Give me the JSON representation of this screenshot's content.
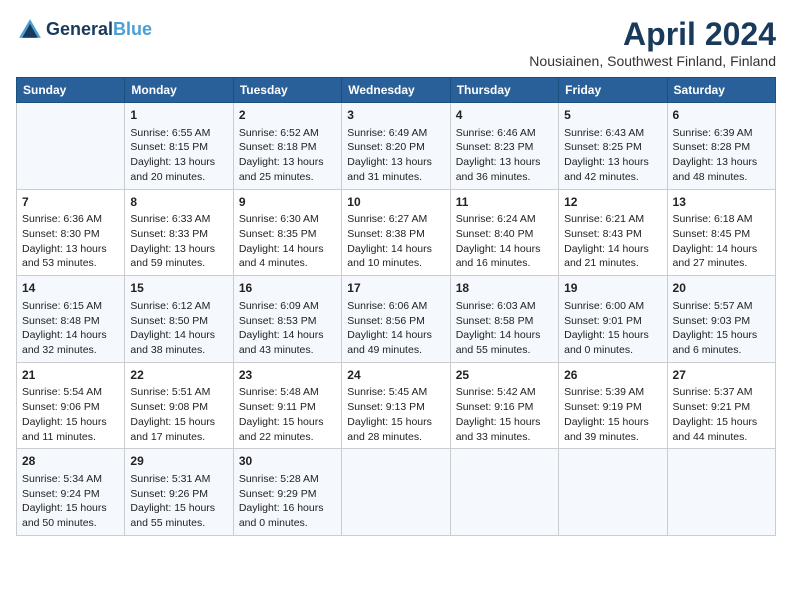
{
  "header": {
    "logo_line1": "General",
    "logo_line2": "Blue",
    "month": "April 2024",
    "location": "Nousiainen, Southwest Finland, Finland"
  },
  "days_of_week": [
    "Sunday",
    "Monday",
    "Tuesday",
    "Wednesday",
    "Thursday",
    "Friday",
    "Saturday"
  ],
  "weeks": [
    [
      {
        "day": "",
        "info": ""
      },
      {
        "day": "1",
        "info": "Sunrise: 6:55 AM\nSunset: 8:15 PM\nDaylight: 13 hours\nand 20 minutes."
      },
      {
        "day": "2",
        "info": "Sunrise: 6:52 AM\nSunset: 8:18 PM\nDaylight: 13 hours\nand 25 minutes."
      },
      {
        "day": "3",
        "info": "Sunrise: 6:49 AM\nSunset: 8:20 PM\nDaylight: 13 hours\nand 31 minutes."
      },
      {
        "day": "4",
        "info": "Sunrise: 6:46 AM\nSunset: 8:23 PM\nDaylight: 13 hours\nand 36 minutes."
      },
      {
        "day": "5",
        "info": "Sunrise: 6:43 AM\nSunset: 8:25 PM\nDaylight: 13 hours\nand 42 minutes."
      },
      {
        "day": "6",
        "info": "Sunrise: 6:39 AM\nSunset: 8:28 PM\nDaylight: 13 hours\nand 48 minutes."
      }
    ],
    [
      {
        "day": "7",
        "info": "Sunrise: 6:36 AM\nSunset: 8:30 PM\nDaylight: 13 hours\nand 53 minutes."
      },
      {
        "day": "8",
        "info": "Sunrise: 6:33 AM\nSunset: 8:33 PM\nDaylight: 13 hours\nand 59 minutes."
      },
      {
        "day": "9",
        "info": "Sunrise: 6:30 AM\nSunset: 8:35 PM\nDaylight: 14 hours\nand 4 minutes."
      },
      {
        "day": "10",
        "info": "Sunrise: 6:27 AM\nSunset: 8:38 PM\nDaylight: 14 hours\nand 10 minutes."
      },
      {
        "day": "11",
        "info": "Sunrise: 6:24 AM\nSunset: 8:40 PM\nDaylight: 14 hours\nand 16 minutes."
      },
      {
        "day": "12",
        "info": "Sunrise: 6:21 AM\nSunset: 8:43 PM\nDaylight: 14 hours\nand 21 minutes."
      },
      {
        "day": "13",
        "info": "Sunrise: 6:18 AM\nSunset: 8:45 PM\nDaylight: 14 hours\nand 27 minutes."
      }
    ],
    [
      {
        "day": "14",
        "info": "Sunrise: 6:15 AM\nSunset: 8:48 PM\nDaylight: 14 hours\nand 32 minutes."
      },
      {
        "day": "15",
        "info": "Sunrise: 6:12 AM\nSunset: 8:50 PM\nDaylight: 14 hours\nand 38 minutes."
      },
      {
        "day": "16",
        "info": "Sunrise: 6:09 AM\nSunset: 8:53 PM\nDaylight: 14 hours\nand 43 minutes."
      },
      {
        "day": "17",
        "info": "Sunrise: 6:06 AM\nSunset: 8:56 PM\nDaylight: 14 hours\nand 49 minutes."
      },
      {
        "day": "18",
        "info": "Sunrise: 6:03 AM\nSunset: 8:58 PM\nDaylight: 14 hours\nand 55 minutes."
      },
      {
        "day": "19",
        "info": "Sunrise: 6:00 AM\nSunset: 9:01 PM\nDaylight: 15 hours\nand 0 minutes."
      },
      {
        "day": "20",
        "info": "Sunrise: 5:57 AM\nSunset: 9:03 PM\nDaylight: 15 hours\nand 6 minutes."
      }
    ],
    [
      {
        "day": "21",
        "info": "Sunrise: 5:54 AM\nSunset: 9:06 PM\nDaylight: 15 hours\nand 11 minutes."
      },
      {
        "day": "22",
        "info": "Sunrise: 5:51 AM\nSunset: 9:08 PM\nDaylight: 15 hours\nand 17 minutes."
      },
      {
        "day": "23",
        "info": "Sunrise: 5:48 AM\nSunset: 9:11 PM\nDaylight: 15 hours\nand 22 minutes."
      },
      {
        "day": "24",
        "info": "Sunrise: 5:45 AM\nSunset: 9:13 PM\nDaylight: 15 hours\nand 28 minutes."
      },
      {
        "day": "25",
        "info": "Sunrise: 5:42 AM\nSunset: 9:16 PM\nDaylight: 15 hours\nand 33 minutes."
      },
      {
        "day": "26",
        "info": "Sunrise: 5:39 AM\nSunset: 9:19 PM\nDaylight: 15 hours\nand 39 minutes."
      },
      {
        "day": "27",
        "info": "Sunrise: 5:37 AM\nSunset: 9:21 PM\nDaylight: 15 hours\nand 44 minutes."
      }
    ],
    [
      {
        "day": "28",
        "info": "Sunrise: 5:34 AM\nSunset: 9:24 PM\nDaylight: 15 hours\nand 50 minutes."
      },
      {
        "day": "29",
        "info": "Sunrise: 5:31 AM\nSunset: 9:26 PM\nDaylight: 15 hours\nand 55 minutes."
      },
      {
        "day": "30",
        "info": "Sunrise: 5:28 AM\nSunset: 9:29 PM\nDaylight: 16 hours\nand 0 minutes."
      },
      {
        "day": "",
        "info": ""
      },
      {
        "day": "",
        "info": ""
      },
      {
        "day": "",
        "info": ""
      },
      {
        "day": "",
        "info": ""
      }
    ]
  ]
}
